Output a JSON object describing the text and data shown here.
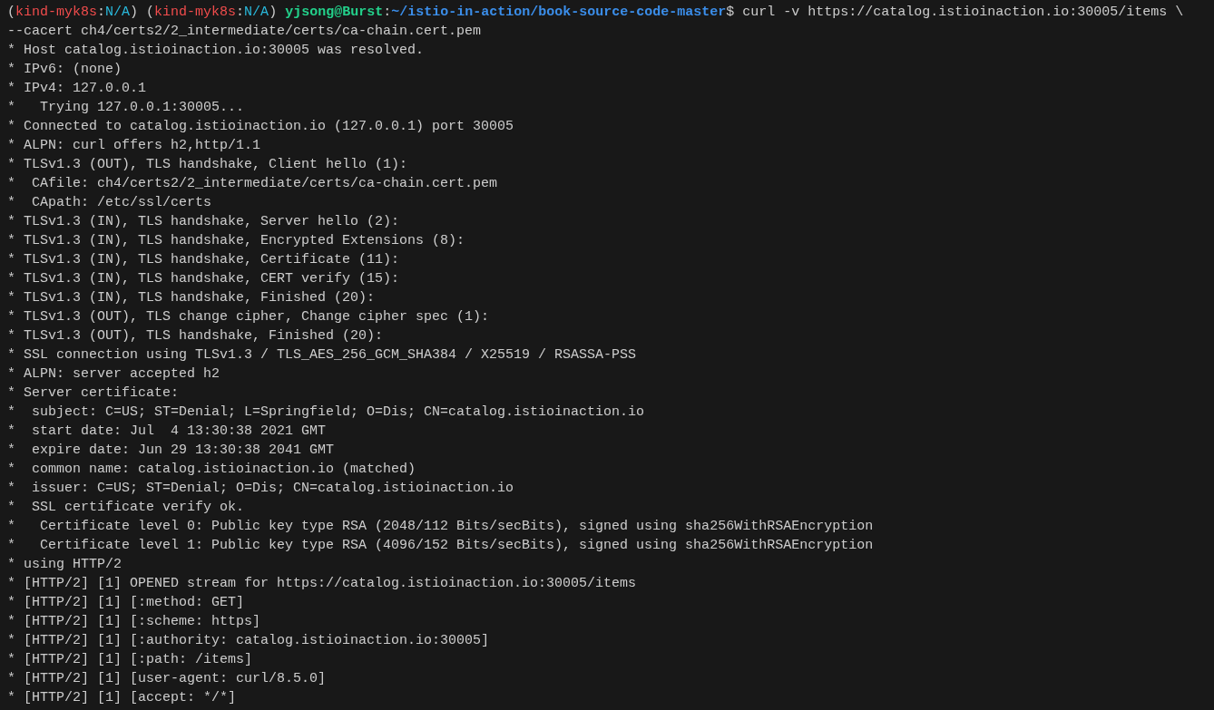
{
  "prompt": {
    "segments": [
      {
        "text": "(",
        "color": "#cccccc",
        "bold": false
      },
      {
        "text": "kind-myk8s",
        "color": "#f14c4c",
        "bold": false
      },
      {
        "text": ":",
        "color": "#cccccc",
        "bold": false
      },
      {
        "text": "N/A",
        "color": "#29b8db",
        "bold": false
      },
      {
        "text": ") (",
        "color": "#cccccc",
        "bold": false
      },
      {
        "text": "kind-myk8s",
        "color": "#f14c4c",
        "bold": false
      },
      {
        "text": ":",
        "color": "#cccccc",
        "bold": false
      },
      {
        "text": "N/A",
        "color": "#29b8db",
        "bold": false
      },
      {
        "text": ") ",
        "color": "#cccccc",
        "bold": false
      },
      {
        "text": "yjsong@Burst",
        "color": "#23d18b",
        "bold": true
      },
      {
        "text": ":",
        "color": "#cccccc",
        "bold": false
      },
      {
        "text": "~/istio-in-action/book-source-code-master",
        "color": "#3b8eea",
        "bold": true
      },
      {
        "text": "$ curl -v https://catalog.istioinaction.io:30005/items \\",
        "color": "#cccccc",
        "bold": false
      }
    ]
  },
  "output_lines": [
    "--cacert ch4/certs2/2_intermediate/certs/ca-chain.cert.pem",
    "* Host catalog.istioinaction.io:30005 was resolved.",
    "* IPv6: (none)",
    "* IPv4: 127.0.0.1",
    "*   Trying 127.0.0.1:30005...",
    "* Connected to catalog.istioinaction.io (127.0.0.1) port 30005",
    "* ALPN: curl offers h2,http/1.1",
    "* TLSv1.3 (OUT), TLS handshake, Client hello (1):",
    "*  CAfile: ch4/certs2/2_intermediate/certs/ca-chain.cert.pem",
    "*  CApath: /etc/ssl/certs",
    "* TLSv1.3 (IN), TLS handshake, Server hello (2):",
    "* TLSv1.3 (IN), TLS handshake, Encrypted Extensions (8):",
    "* TLSv1.3 (IN), TLS handshake, Certificate (11):",
    "* TLSv1.3 (IN), TLS handshake, CERT verify (15):",
    "* TLSv1.3 (IN), TLS handshake, Finished (20):",
    "* TLSv1.3 (OUT), TLS change cipher, Change cipher spec (1):",
    "* TLSv1.3 (OUT), TLS handshake, Finished (20):",
    "* SSL connection using TLSv1.3 / TLS_AES_256_GCM_SHA384 / X25519 / RSASSA-PSS",
    "* ALPN: server accepted h2",
    "* Server certificate:",
    "*  subject: C=US; ST=Denial; L=Springfield; O=Dis; CN=catalog.istioinaction.io",
    "*  start date: Jul  4 13:30:38 2021 GMT",
    "*  expire date: Jun 29 13:30:38 2041 GMT",
    "*  common name: catalog.istioinaction.io (matched)",
    "*  issuer: C=US; ST=Denial; O=Dis; CN=catalog.istioinaction.io",
    "*  SSL certificate verify ok.",
    "*   Certificate level 0: Public key type RSA (2048/112 Bits/secBits), signed using sha256WithRSAEncryption",
    "*   Certificate level 1: Public key type RSA (4096/152 Bits/secBits), signed using sha256WithRSAEncryption",
    "* using HTTP/2",
    "* [HTTP/2] [1] OPENED stream for https://catalog.istioinaction.io:30005/items",
    "* [HTTP/2] [1] [:method: GET]",
    "* [HTTP/2] [1] [:scheme: https]",
    "* [HTTP/2] [1] [:authority: catalog.istioinaction.io:30005]",
    "* [HTTP/2] [1] [:path: /items]",
    "* [HTTP/2] [1] [user-agent: curl/8.5.0]",
    "* [HTTP/2] [1] [accept: */*]"
  ]
}
